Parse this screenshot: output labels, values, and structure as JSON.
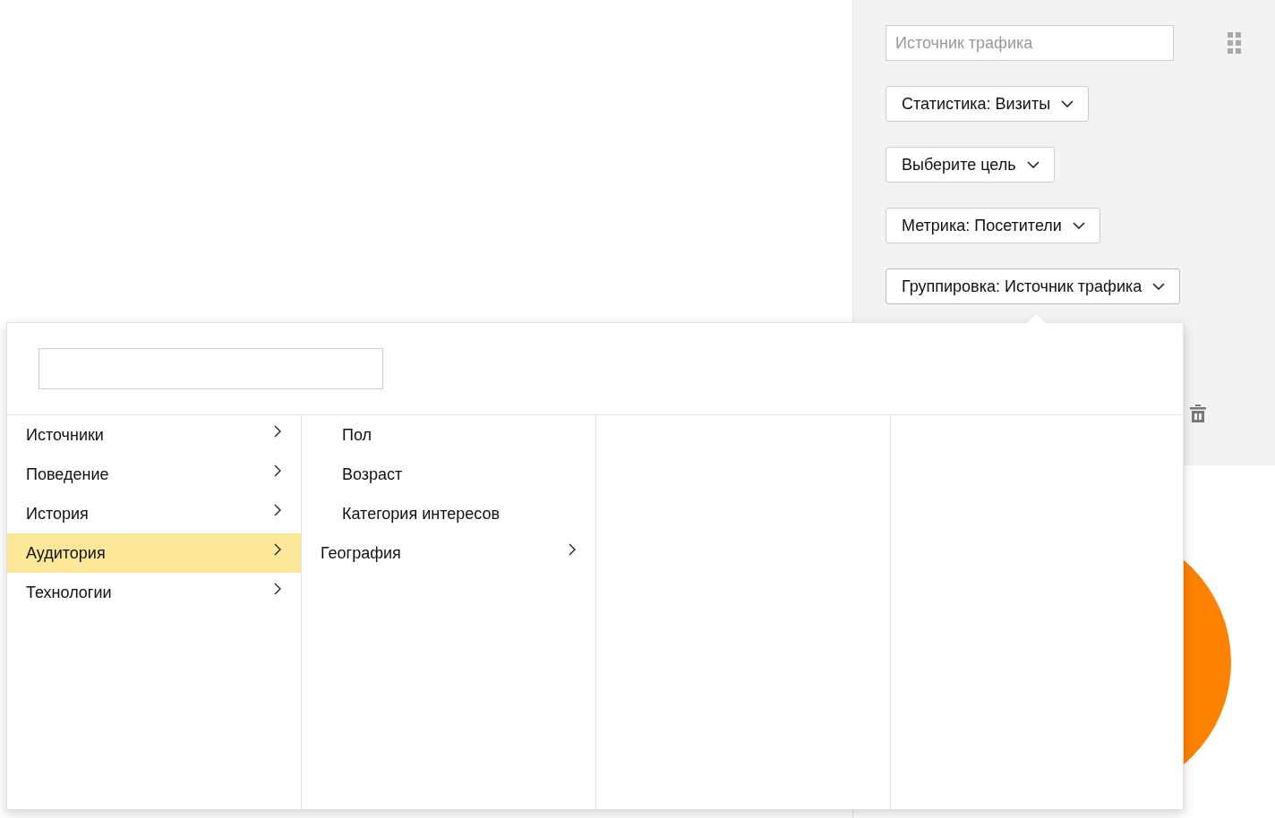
{
  "panel": {
    "search": {
      "placeholder": "Источник трафика"
    },
    "dropdowns": [
      {
        "label": "Статистика: Визиты",
        "open": false
      },
      {
        "label": "Выберите цель",
        "open": false
      },
      {
        "label": "Метрика: Посетители",
        "open": false
      },
      {
        "label": "Группировка: Источник трафика",
        "open": true
      }
    ]
  },
  "menu": {
    "items": [
      {
        "label": "Источники",
        "expandable": true,
        "selected": false
      },
      {
        "label": "Поведение",
        "expandable": true,
        "selected": false
      },
      {
        "label": "История",
        "expandable": true,
        "selected": false
      },
      {
        "label": "Аудитория",
        "expandable": true,
        "selected": true,
        "children": [
          {
            "label": "Пол",
            "expandable": false
          },
          {
            "label": "Возраст",
            "expandable": false
          },
          {
            "label": "Категория интересов",
            "expandable": false
          },
          {
            "label": "География",
            "expandable": true
          }
        ]
      },
      {
        "label": "Технологии",
        "expandable": true,
        "selected": false
      }
    ]
  }
}
